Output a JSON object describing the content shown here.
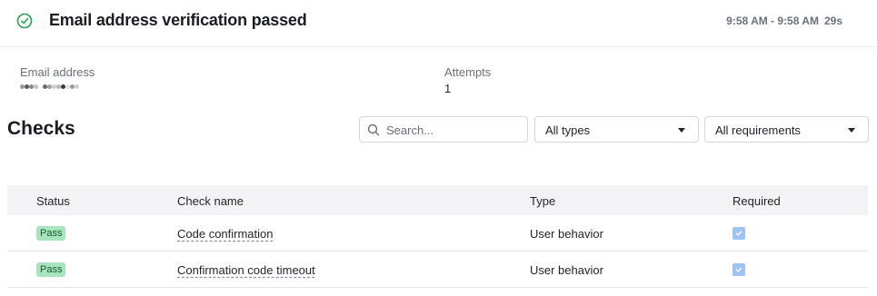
{
  "header": {
    "title": "Email address verification passed",
    "time_range": "9:58 AM - 9:58 AM",
    "duration": "29s",
    "status_color": "#2e9e54"
  },
  "summary": {
    "email_label": "Email address",
    "email_value_redacted": true,
    "attempts_label": "Attempts",
    "attempts_value": "1"
  },
  "checks": {
    "title": "Checks",
    "search_placeholder": "Search...",
    "type_filter": "All types",
    "requirement_filter": "All requirements",
    "columns": {
      "status": "Status",
      "name": "Check name",
      "type": "Type",
      "required": "Required"
    },
    "rows": [
      {
        "status": "Pass",
        "name": "Code confirmation",
        "type": "User behavior",
        "required": true
      },
      {
        "status": "Pass",
        "name": "Confirmation code timeout",
        "type": "User behavior",
        "required": true
      }
    ]
  }
}
